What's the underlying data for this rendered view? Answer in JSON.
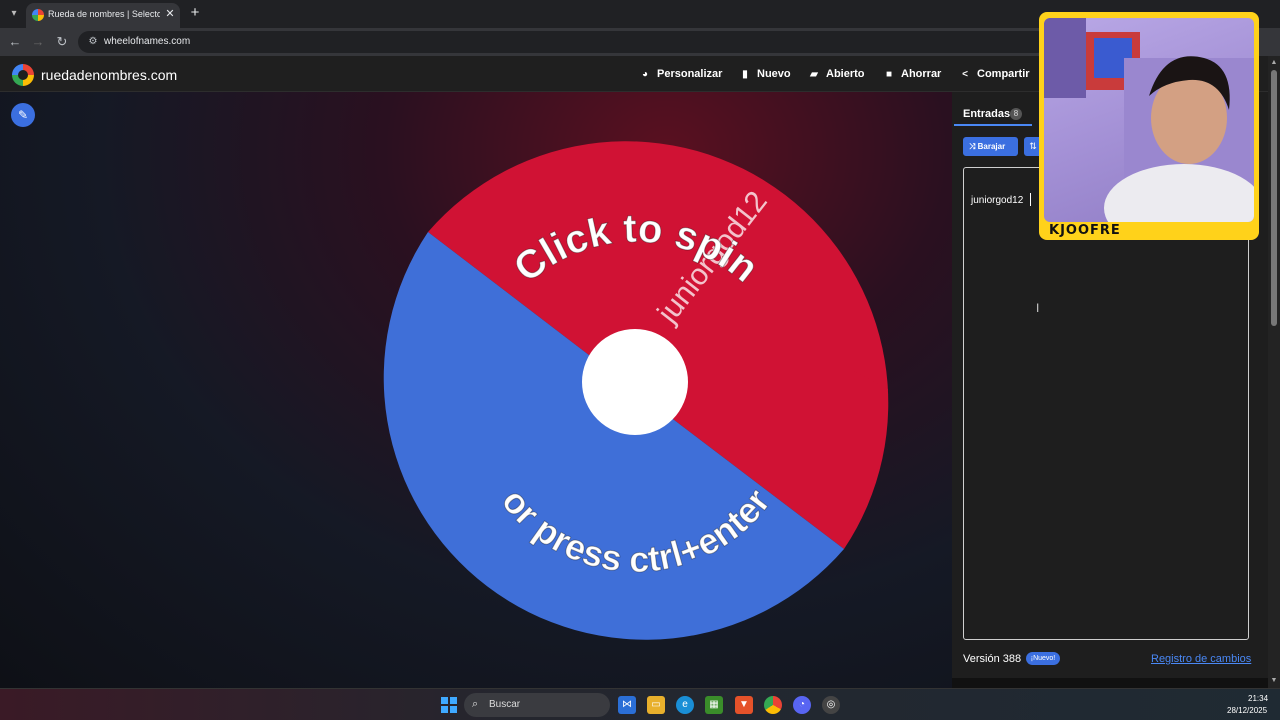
{
  "browser": {
    "tab_title": "Rueda de nombres | Selector de",
    "tab_close": "✕",
    "new_tab": "+",
    "url": "wheelofnames.com"
  },
  "site": {
    "logo_text": "ruedadenombres.com",
    "menu": [
      {
        "label": "Personalizar",
        "icon": "palette-icon"
      },
      {
        "label": "Nuevo",
        "icon": "file-icon"
      },
      {
        "label": "Abierto",
        "icon": "folder-open-icon"
      },
      {
        "label": "Ahorrar",
        "icon": "save-icon"
      },
      {
        "label": "Compartir",
        "icon": "share-icon"
      }
    ]
  },
  "wheel": {
    "entry_label": "juniorgod12",
    "top_prompt": "Click to spin",
    "bottom_prompt": "or press ctrl+enter",
    "colors": {
      "red": "#d01234",
      "blue": "#3f6fd8"
    }
  },
  "panel": {
    "tab_label": "Entradas",
    "count": "8",
    "shuffle_label": "Barajar",
    "entries": [
      "juniorgod12"
    ],
    "version": "Versión 388",
    "new_badge": "¡Nuevo!",
    "changelog": "Registro de cambios"
  },
  "webcam": {
    "label": "KJOOFRE"
  },
  "taskbar": {
    "search_placeholder": "Buscar",
    "time": "21:34",
    "date": "28/12/2025"
  }
}
